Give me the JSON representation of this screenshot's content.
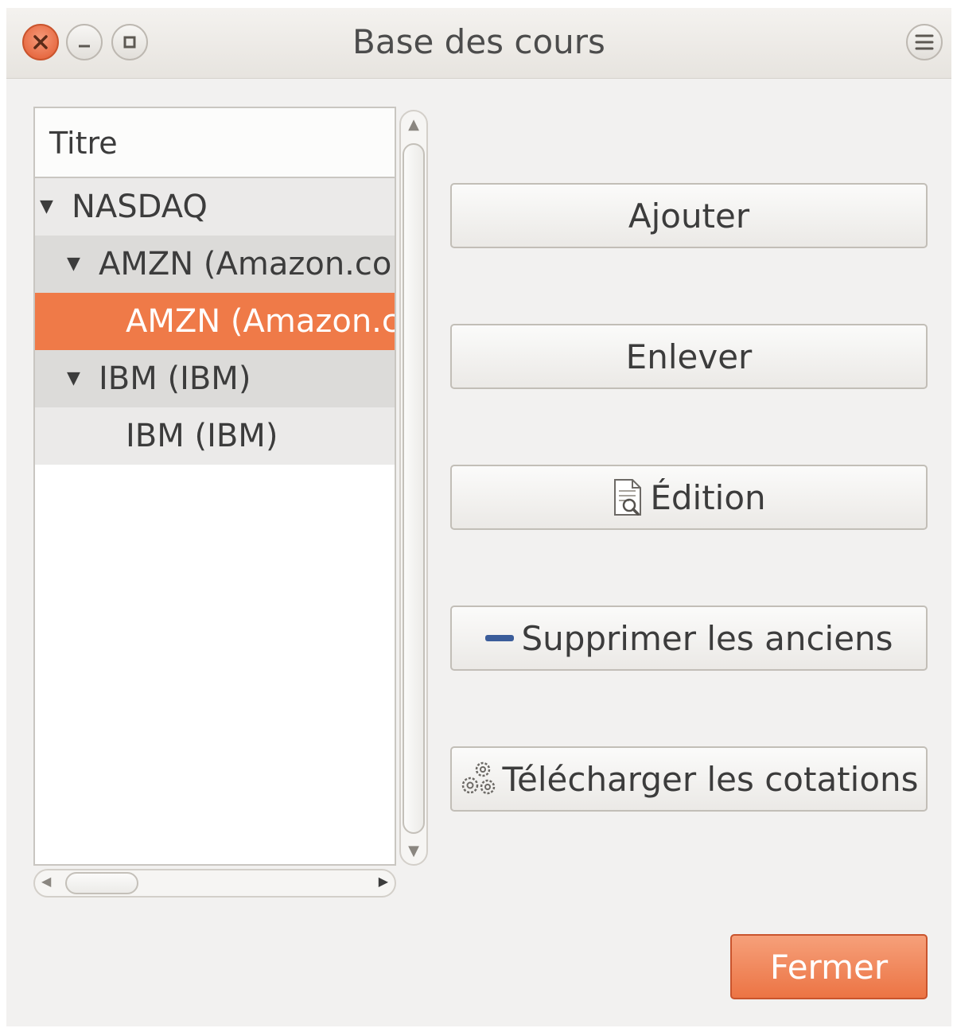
{
  "window": {
    "title": "Base des cours"
  },
  "tree": {
    "header": "Titre",
    "rows": [
      {
        "label": "NASDAQ",
        "level": 0,
        "expanded": true,
        "selected": false
      },
      {
        "label": "AMZN (Amazon.com, Inc.)",
        "level": 1,
        "expanded": true,
        "selected": false
      },
      {
        "label": "AMZN (Amazon.com, Inc.)",
        "level": 2,
        "expanded": false,
        "selected": true
      },
      {
        "label": "IBM (IBM)",
        "level": 1,
        "expanded": true,
        "selected": false
      },
      {
        "label": "IBM (IBM)",
        "level": 2,
        "expanded": false,
        "selected": false
      }
    ]
  },
  "buttons": {
    "add": "Ajouter",
    "remove": "Enlever",
    "edit": "Édition",
    "delete_old": "Supprimer les anciens",
    "download": "Télécharger les cotations",
    "close": "Fermer"
  },
  "colors": {
    "accent": "#ef7a48",
    "window_bg": "#f2f1f0"
  }
}
